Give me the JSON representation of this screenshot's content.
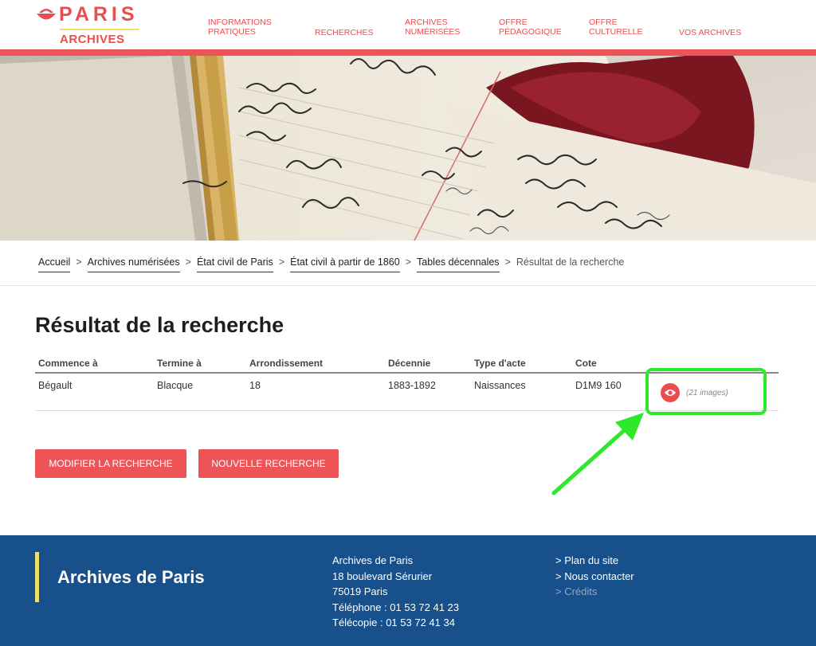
{
  "header": {
    "logo_text": "PARIS",
    "logo_sub": "ARCHIVES",
    "nav": [
      {
        "label": "INFORMATIONS\nPRATIQUES"
      },
      {
        "label": "RECHERCHES"
      },
      {
        "label": "ARCHIVES\nNUMÉRISÉES"
      },
      {
        "label": "OFFRE\nPÉDAGOGIQUE"
      },
      {
        "label": "OFFRE\nCULTURELLE"
      },
      {
        "label": "VOS ARCHIVES"
      }
    ]
  },
  "breadcrumb": {
    "items": [
      "Accueil",
      "Archives numérisées",
      "État civil de Paris",
      "État civil à partir de 1860",
      "Tables décennales"
    ],
    "separator": ">",
    "current": "Résultat de la recherche"
  },
  "results": {
    "title": "Résultat de la recherche",
    "columns": [
      "Commence à",
      "Termine à",
      "Arrondissement",
      "Décennie",
      "Type d'acte",
      "Cote"
    ],
    "rows": [
      {
        "commence": "Bégault",
        "termine": "Blacque",
        "arrondissement": "18",
        "decennie": "1883-1892",
        "type": "Naissances",
        "cote": "D1M9 160",
        "images": "(21 images)",
        "view_icon": "eye-icon"
      }
    ]
  },
  "buttons": {
    "modify": "MODIFIER LA RECHERCHE",
    "new": "NOUVELLE RECHERCHE"
  },
  "footer": {
    "title": "Archives de Paris",
    "address": [
      "Archives de Paris",
      "18 boulevard Sérurier",
      "75019 Paris",
      "Téléphone : 01 53 72 41 23",
      "Télécopie : 01 53 72 41 34"
    ],
    "links": [
      "> Plan du site",
      "> Nous contacter",
      "> Crédits"
    ]
  },
  "colors": {
    "brand_red": "#ea4d4f",
    "brand_yellow": "#f1df6c",
    "footer_blue": "#17508a",
    "highlight_green": "#2ee82a"
  }
}
